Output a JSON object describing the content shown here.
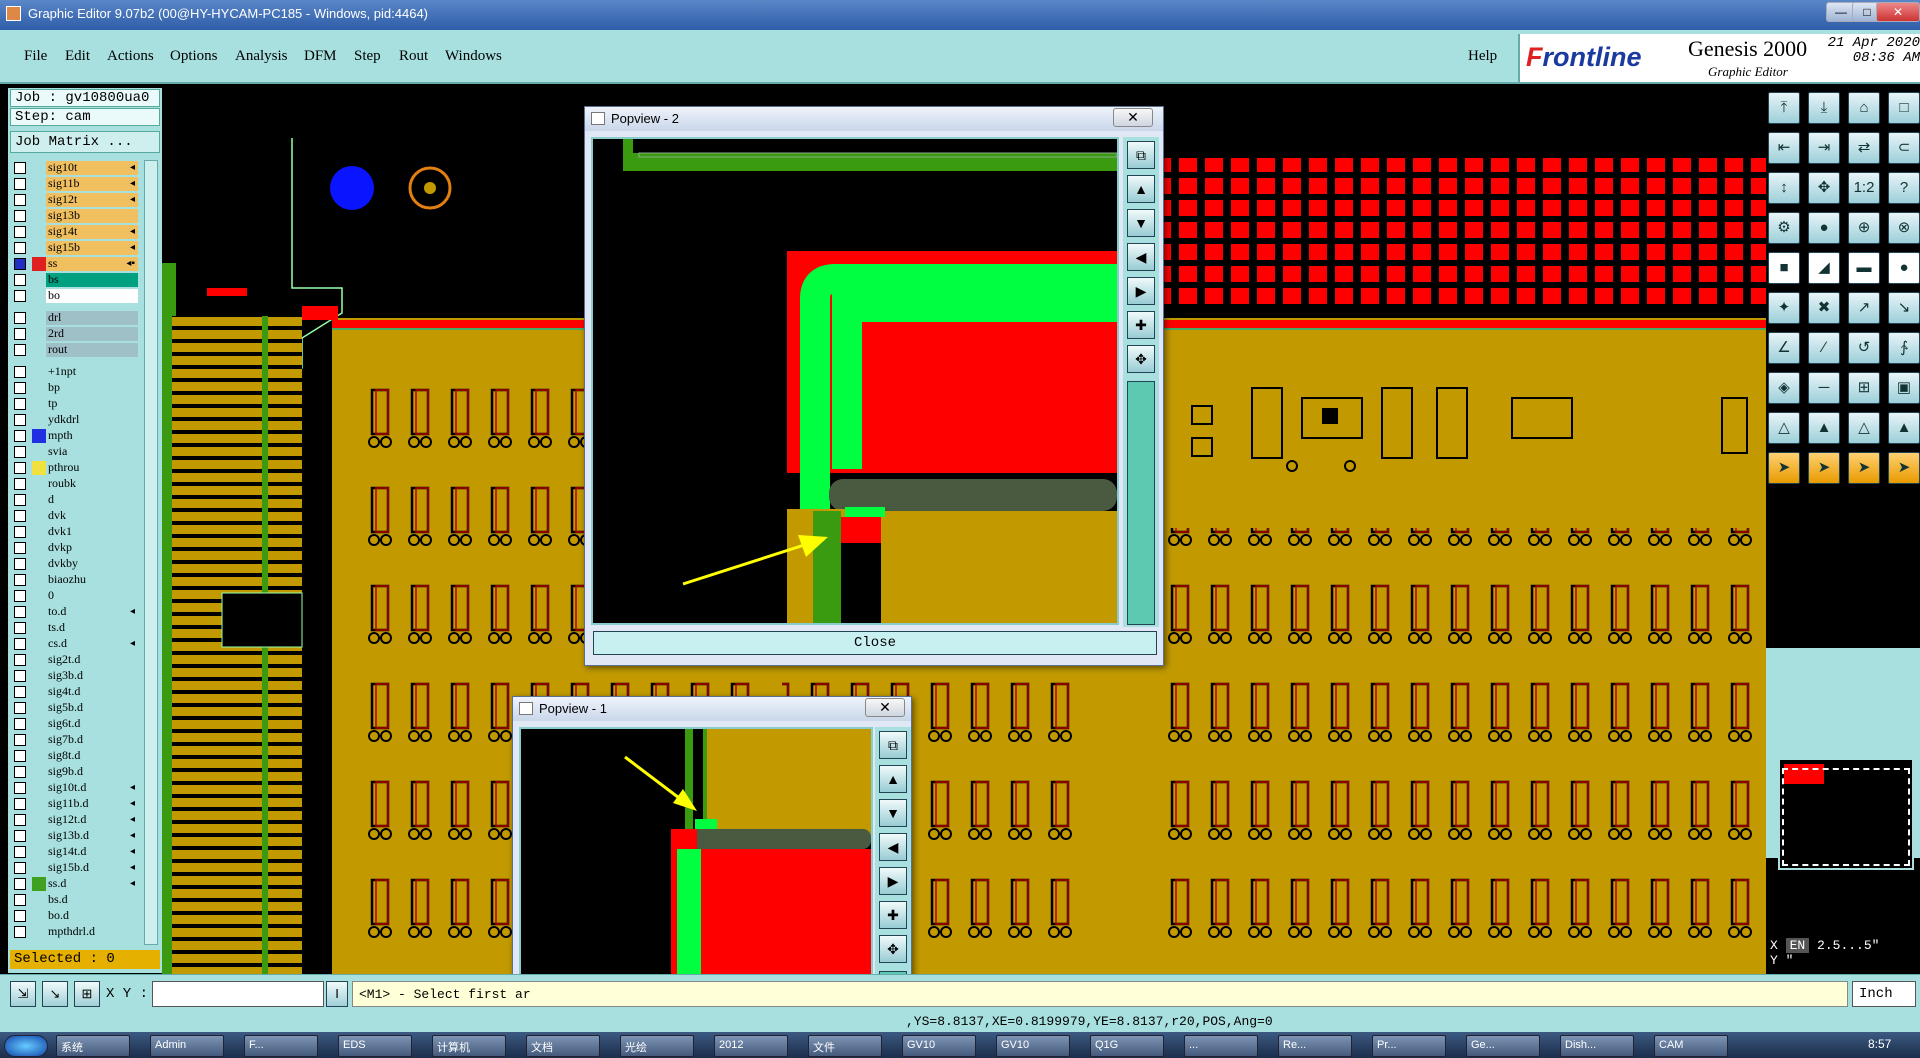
{
  "window": {
    "title": "Graphic Editor 9.07b2 (00@HY-HYCAM-PC185 - Windows, pid:4464)"
  },
  "menu": [
    "File",
    "Edit",
    "Actions",
    "Options",
    "Analysis",
    "DFM",
    "Step",
    "Rout",
    "Windows"
  ],
  "help": "Help",
  "logo": {
    "brand_pre": "F",
    "brand_rest": "rontline",
    "product": "Genesis 2000",
    "subtitle": "Graphic Editor",
    "date": "21 Apr 2020",
    "time": "08:36 AM"
  },
  "job": "Job : gv10800ua0",
  "step": "Step: cam",
  "job_matrix": "Job Matrix ...",
  "layers": [
    {
      "name": "sig10t",
      "color": "#f0c060",
      "sw": "",
      "flag": "◂"
    },
    {
      "name": "sig11b",
      "color": "#f0c060",
      "sw": "",
      "flag": "◂"
    },
    {
      "name": "sig12t",
      "color": "#f0c060",
      "sw": "",
      "flag": "◂"
    },
    {
      "name": "sig13b",
      "color": "#f0c060",
      "sw": "",
      "flag": ""
    },
    {
      "name": "sig14t",
      "color": "#f0c060",
      "sw": "",
      "flag": "◂"
    },
    {
      "name": "sig15b",
      "color": "#f0c060",
      "sw": "",
      "flag": "◂"
    },
    {
      "name": "ss",
      "color": "#f0c060",
      "sw": "#e02020",
      "flag": "◂▪",
      "cbsel": true
    },
    {
      "name": "bs",
      "color": "#00a080",
      "sw": "",
      "flag": ""
    },
    {
      "name": "bo",
      "color": "#ffffff",
      "sw": "",
      "flag": ""
    },
    {
      "name": "",
      "color": "",
      "sw": "",
      "flag": "",
      "gap": true
    },
    {
      "name": "drl",
      "color": "#a0c0c8",
      "sw": "",
      "flag": ""
    },
    {
      "name": "2rd",
      "color": "#a0c0c8",
      "sw": "",
      "flag": ""
    },
    {
      "name": "rout",
      "color": "#a0c0c8",
      "sw": "",
      "flag": ""
    },
    {
      "name": "",
      "color": "",
      "sw": "",
      "flag": "",
      "gap": true
    },
    {
      "name": "+1npt",
      "color": "",
      "sw": "",
      "flag": ""
    },
    {
      "name": "bp",
      "color": "",
      "sw": "",
      "flag": ""
    },
    {
      "name": "tp",
      "color": "",
      "sw": "",
      "flag": ""
    },
    {
      "name": "ydkdrl",
      "color": "",
      "sw": "",
      "flag": ""
    },
    {
      "name": "mpth",
      "color": "",
      "sw": "#2030e0",
      "flag": ""
    },
    {
      "name": "svia",
      "color": "",
      "sw": "",
      "flag": ""
    },
    {
      "name": "pthrou",
      "color": "",
      "sw": "#f0e040",
      "flag": ""
    },
    {
      "name": "roubk",
      "color": "",
      "sw": "",
      "flag": ""
    },
    {
      "name": "d",
      "color": "",
      "sw": "",
      "flag": ""
    },
    {
      "name": "dvk",
      "color": "",
      "sw": "",
      "flag": ""
    },
    {
      "name": "dvk1",
      "color": "",
      "sw": "",
      "flag": ""
    },
    {
      "name": "dvkp",
      "color": "",
      "sw": "",
      "flag": ""
    },
    {
      "name": "dvkby",
      "color": "",
      "sw": "",
      "flag": ""
    },
    {
      "name": "biaozhu",
      "color": "",
      "sw": "",
      "flag": ""
    },
    {
      "name": "0",
      "color": "",
      "sw": "",
      "flag": ""
    },
    {
      "name": "to.d",
      "color": "",
      "sw": "",
      "flag": "◂"
    },
    {
      "name": "ts.d",
      "color": "",
      "sw": "",
      "flag": ""
    },
    {
      "name": "cs.d",
      "color": "",
      "sw": "",
      "flag": "◂"
    },
    {
      "name": "sig2t.d",
      "color": "",
      "sw": "",
      "flag": ""
    },
    {
      "name": "sig3b.d",
      "color": "",
      "sw": "",
      "flag": ""
    },
    {
      "name": "sig4t.d",
      "color": "",
      "sw": "",
      "flag": ""
    },
    {
      "name": "sig5b.d",
      "color": "",
      "sw": "",
      "flag": ""
    },
    {
      "name": "sig6t.d",
      "color": "",
      "sw": "",
      "flag": ""
    },
    {
      "name": "sig7b.d",
      "color": "",
      "sw": "",
      "flag": ""
    },
    {
      "name": "sig8t.d",
      "color": "",
      "sw": "",
      "flag": ""
    },
    {
      "name": "sig9b.d",
      "color": "",
      "sw": "",
      "flag": ""
    },
    {
      "name": "sig10t.d",
      "color": "",
      "sw": "",
      "flag": "◂"
    },
    {
      "name": "sig11b.d",
      "color": "",
      "sw": "",
      "flag": "◂"
    },
    {
      "name": "sig12t.d",
      "color": "",
      "sw": "",
      "flag": "◂"
    },
    {
      "name": "sig13b.d",
      "color": "",
      "sw": "",
      "flag": "◂"
    },
    {
      "name": "sig14t.d",
      "color": "",
      "sw": "",
      "flag": "◂"
    },
    {
      "name": "sig15b.d",
      "color": "",
      "sw": "",
      "flag": "◂"
    },
    {
      "name": "ss.d",
      "color": "",
      "sw": "#40a020",
      "flag": "◂"
    },
    {
      "name": "bs.d",
      "color": "",
      "sw": "",
      "flag": ""
    },
    {
      "name": "bo.d",
      "color": "",
      "sw": "",
      "flag": ""
    },
    {
      "name": "mpthdrl.d",
      "color": "",
      "sw": "",
      "flag": ""
    }
  ],
  "selected": "Selected : 0",
  "popup2": {
    "title": "Popview - 2",
    "close": "Close"
  },
  "popup1": {
    "title": "Popview - 1"
  },
  "xy_label": "X Y :",
  "prompt": "<M1> - Select first ar",
  "unit": "Inch",
  "status": ",YS=8.8137,XE=0.8199979,YE=8.8137,r20,POS,Ang=0",
  "readout": {
    "x": "X",
    "y": "Y",
    "xval": "2.5...5\"",
    "yval": "\""
  },
  "taskbar": [
    "",
    "系统",
    "Admin",
    "F...",
    "EDS",
    "计算机",
    "文档",
    "光绘",
    "2012",
    "文件",
    "GV10",
    "GV10",
    "Q1G",
    "...",
    "Re...",
    "Pr...",
    "Ge...",
    "Dish...",
    "CAM"
  ],
  "clock": "8:57",
  "colors": {
    "board": "#c29a00",
    "copper": "#ff0000",
    "green": "#00e040",
    "dkgreen": "#3a9a10",
    "mask": "#4a5a40",
    "arrow": "#f0f000"
  }
}
